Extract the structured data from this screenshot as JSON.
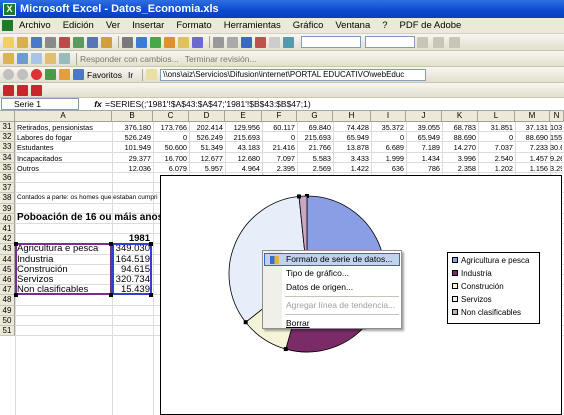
{
  "window": {
    "title": "Microsoft Excel - Datos_Economia.xls"
  },
  "menu": [
    "Archivo",
    "Edición",
    "Ver",
    "Insertar",
    "Formato",
    "Herramientas",
    "Gráfico",
    "Ventana",
    "?",
    "PDF de Adobe"
  ],
  "toolbar3": {
    "responder": "Responder con cambios...",
    "terminar": "Terminar revisión..."
  },
  "toolbar4": {
    "favoritos": "Favoritos",
    "ir": "Ir",
    "address": "\\\\ons\\aiz\\Servicios\\Difusion\\internet\\PORTAL EDUCATIVO\\webEduc"
  },
  "namebox": "Serie 1",
  "formula": "=SERIES(;'1981'!$A$43:$A$47;'1981'!$B$43:$B$47;1)",
  "columns": [
    "A",
    "B",
    "C",
    "D",
    "E",
    "F",
    "G",
    "H",
    "I",
    "J",
    "K",
    "L",
    "M",
    "N",
    "O"
  ],
  "rows": [
    {
      "n": "31",
      "a": "Retirados, pensionistas",
      "v": [
        "376.180",
        "173.766",
        "202.414",
        "129.956",
        "60.117",
        "69.840",
        "74.428",
        "35.372",
        "39.055",
        "68.783",
        "31.851",
        "37.131",
        "103.013",
        "46"
      ]
    },
    {
      "n": "32",
      "a": "Labores do fogar",
      "v": [
        "526.249",
        "0",
        "526.249",
        "215.693",
        "0",
        "215.693",
        "65.949",
        "0",
        "65.949",
        "88.690",
        "0",
        "88.690",
        "155.917",
        ""
      ]
    },
    {
      "n": "33",
      "a": "Estudantes",
      "v": [
        "101.949",
        "50.600",
        "51.349",
        "43.183",
        "21.416",
        "21.766",
        "13.878",
        "6.689",
        "7.189",
        "14.270",
        "7.037",
        "7.233",
        "30.618",
        "15"
      ]
    },
    {
      "n": "34",
      "a": "Incapacitados",
      "v": [
        "29.377",
        "16.700",
        "12.677",
        "12.680",
        "7.097",
        "5.583",
        "3.433",
        "1.999",
        "1.434",
        "3.996",
        "2.540",
        "1.457",
        "9.268",
        "5"
      ]
    },
    {
      "n": "35",
      "a": "Outros",
      "v": [
        "12.036",
        "6.079",
        "5.957",
        "4.964",
        "2.395",
        "2.569",
        "1.422",
        "636",
        "786",
        "2.358",
        "1.202",
        "1.156",
        "3.293",
        "1"
      ]
    }
  ],
  "note": "Contados a parte: os homes que estaban cumpri",
  "section_title": "Poboación de 16 ou máis anos",
  "year": "1981",
  "series": [
    {
      "label": "Agricultura e pesca",
      "value": "349.030"
    },
    {
      "label": "Industria",
      "value": "164.519"
    },
    {
      "label": "Construción",
      "value": "94.615"
    },
    {
      "label": "Servizos",
      "value": "320.734"
    },
    {
      "label": "Non clasificables",
      "value": "15.439"
    }
  ],
  "legend": [
    "Agricultura e pesca",
    "Industria",
    "Construción",
    "Servizos",
    "Non clasificables"
  ],
  "chart_data": {
    "type": "pie",
    "categories": [
      "Agricultura e pesca",
      "Industria",
      "Construción",
      "Servizos",
      "Non clasificables"
    ],
    "values": [
      349030,
      164519,
      94615,
      320734,
      15439
    ],
    "colors": [
      "#8a9ee6",
      "#7b2c68",
      "#f5f4d8",
      "#e6eefa",
      "#c9a6c4"
    ]
  },
  "context_menu": [
    {
      "label": "Formato de serie de datos...",
      "state": "highlighted"
    },
    {
      "label": "Tipo de gráfico...",
      "state": "normal"
    },
    {
      "label": "Datos de origen...",
      "state": "normal"
    },
    {
      "label": "Agregar línea de tendencia...",
      "state": "disabled"
    },
    {
      "label": "Borrar",
      "state": "normal"
    }
  ]
}
